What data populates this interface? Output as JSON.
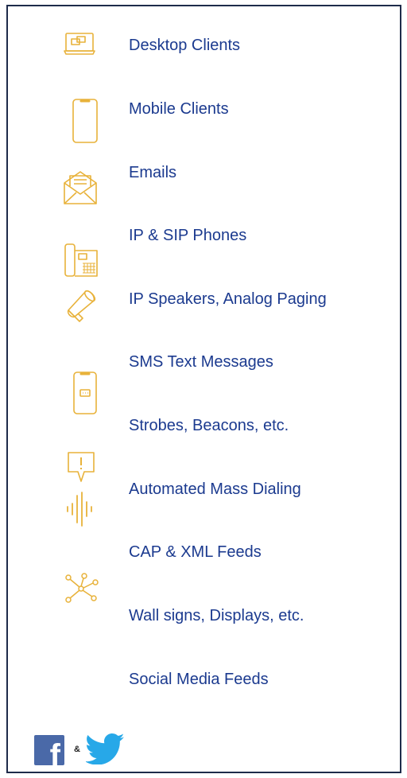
{
  "accent_color": "#e8b23a",
  "text_color": "#1b3a8f",
  "channels": [
    {
      "label": "Desktop Clients",
      "icon": "desktop-icon"
    },
    {
      "label": "Mobile Clients",
      "icon": "mobile-phone-icon"
    },
    {
      "label": "Emails",
      "icon": "envelope-icon"
    },
    {
      "label": "IP & SIP Phones",
      "icon": "desk-phone-icon"
    },
    {
      "label": "IP Speakers, Analog Paging",
      "icon": "megaphone-icon"
    },
    {
      "label": "SMS Text Messages",
      "icon": "sms-phone-icon"
    },
    {
      "label": "Strobes, Beacons, etc.",
      "icon": "alert-sign-icon"
    },
    {
      "label": "Automated Mass Dialing",
      "icon": "sound-wave-icon"
    },
    {
      "label": "CAP & XML Feeds",
      "icon": "network-nodes-icon"
    },
    {
      "label": "Wall signs, Displays, etc.",
      "icon": ""
    },
    {
      "label": "Social Media Feeds",
      "icon": ""
    }
  ],
  "social": {
    "facebook_letter": "f",
    "ampersand": "&",
    "icons": [
      "facebook-icon",
      "twitter-icon"
    ]
  }
}
